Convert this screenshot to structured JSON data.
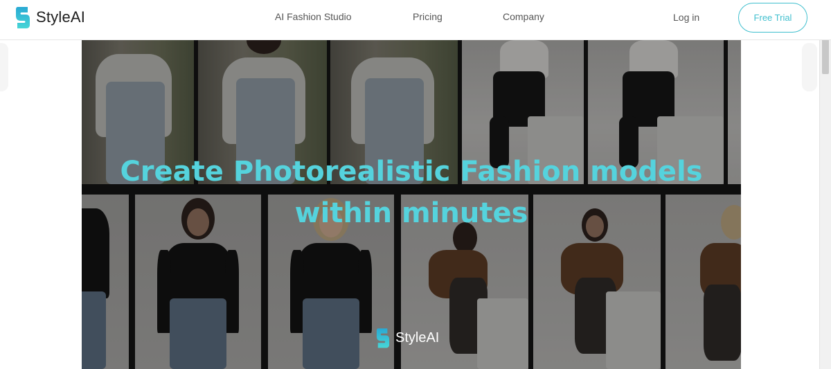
{
  "header": {
    "brand_name": "StyleAI",
    "nav": [
      {
        "label": "AI Fashion Studio"
      },
      {
        "label": "Pricing"
      },
      {
        "label": "Company"
      }
    ],
    "login_label": "Log in",
    "trial_label": "Free Trial"
  },
  "hero": {
    "headline_line1": "Create Photorealistic Fashion models",
    "headline_line2": "within minutes",
    "brand_name": "StyleAI"
  },
  "colors": {
    "accent": "#55d3dd",
    "button_border": "#3fbfce",
    "logo_top": "#29a9d4",
    "logo_bottom": "#47d6d6"
  }
}
